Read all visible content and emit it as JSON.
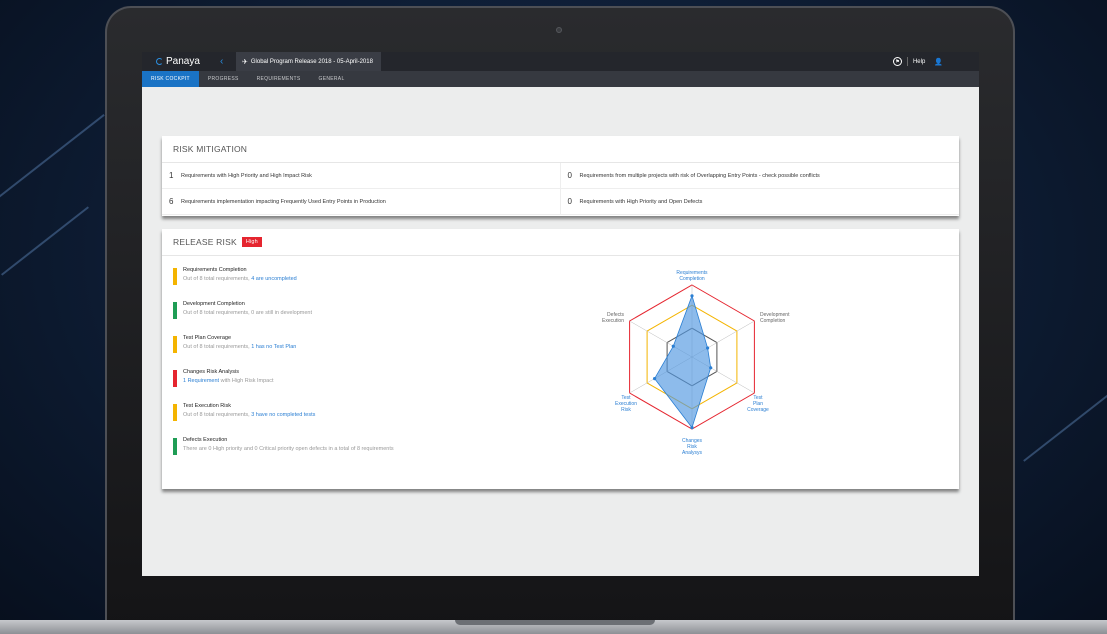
{
  "app": {
    "logo_text": "Panaya",
    "release_title": "Global Program Release 2018 - 05-April-2018",
    "help_label": "Help"
  },
  "tabs": [
    {
      "label": "RISK COCKPIT"
    },
    {
      "label": "PROGRESS"
    },
    {
      "label": "REQUIREMENTS"
    },
    {
      "label": "GENERAL"
    }
  ],
  "risk_mitigation": {
    "title": "RISK MITIGATION",
    "items": [
      {
        "count": "1",
        "text": "Requirements with High Priority and High Impact Risk"
      },
      {
        "count": "0",
        "text": "Requirements from multiple projects with risk of Overlapping Entry Points - check possible conflicts"
      },
      {
        "count": "6",
        "text": "Requirements implementation impacting Frequently Used Entry Points in Production"
      },
      {
        "count": "0",
        "text": "Requirements with High Priority and Open Defects"
      }
    ]
  },
  "release_risk": {
    "title": "RELEASE RISK",
    "level": "High",
    "items": [
      {
        "title": "Requirements Completion",
        "sub": "Out of 8 total requirements, ",
        "link": "4 are uncompleted",
        "rest": "",
        "status": "#f4b400"
      },
      {
        "title": "Development Completion",
        "sub": "Out of 8 total requirements, 0 are still in development",
        "link": "",
        "rest": "",
        "status": "#1f9d55"
      },
      {
        "title": "Test Plan Coverage",
        "sub": "Out of 8 total requirements, ",
        "link": "1 has no Test Plan",
        "rest": "",
        "status": "#f4b400"
      },
      {
        "title": "Changes Risk Analysis",
        "sub": "",
        "link": "1 Requirement",
        "rest": " with High Risk Impact",
        "status": "#e5252f"
      },
      {
        "title": "Test Execution Risk",
        "sub": "Out of 8 total requirements, ",
        "link": "3 have no completed tests",
        "rest": "",
        "status": "#f4b400"
      },
      {
        "title": "Defects Execution",
        "sub": "There are 0 High priority and 0 Critical priority open defects in a total of 8 requirements",
        "link": "",
        "rest": "",
        "status": "#1f9d55"
      }
    ],
    "radar_axes": [
      [
        "Requirements",
        "Completion"
      ],
      [
        "Development",
        "Completion"
      ],
      [
        "Test",
        "Plan",
        "Coverage"
      ],
      [
        "Changes",
        "Risk",
        "Analysys"
      ],
      [
        "Test",
        "Execution",
        "Risk"
      ],
      [
        "Defects",
        "Execution"
      ]
    ],
    "radar_values": [
      0.85,
      0.25,
      0.3,
      0.98,
      0.6,
      0.3
    ]
  },
  "colors": {
    "accent": "#1a73c5",
    "high": "#e5252f",
    "medium": "#f4b400",
    "low": "#1f9d55"
  }
}
